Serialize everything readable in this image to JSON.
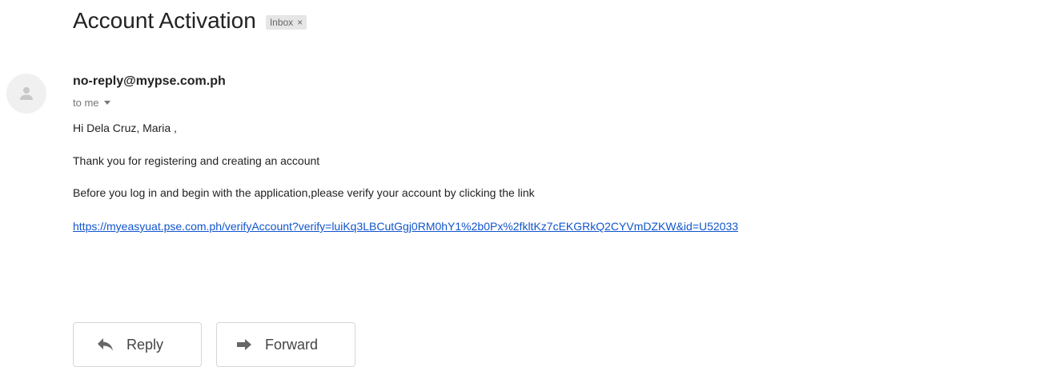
{
  "email": {
    "subject": "Account Activation",
    "label": "Inbox",
    "label_close": "×",
    "sender": "no-reply@mypse.com.ph",
    "recipient": "to me",
    "greeting": "Hi Dela Cruz, Maria ,",
    "thanks": "Thank you for registering and creating an account",
    "instruction": "Before you log in and begin with the application,please verify your account by clicking the link",
    "verify_link": "https://myeasyuat.pse.com.ph/verifyAccount?verify=luiKq3LBCutGgj0RM0hY1%2b0Px%2fkltKz7cEKGRkQ2CYVmDZKW&id=U52033"
  },
  "actions": {
    "reply_label": "Reply",
    "forward_label": "Forward"
  },
  "icons": {
    "avatar": "person-icon",
    "reply": "reply-arrow-icon",
    "forward": "forward-arrow-icon",
    "recipient_menu": "caret-down-icon"
  },
  "colors": {
    "link": "#1155cc",
    "chip_bg": "#e6e6e6",
    "avatar_bg": "#f0f0f0"
  }
}
